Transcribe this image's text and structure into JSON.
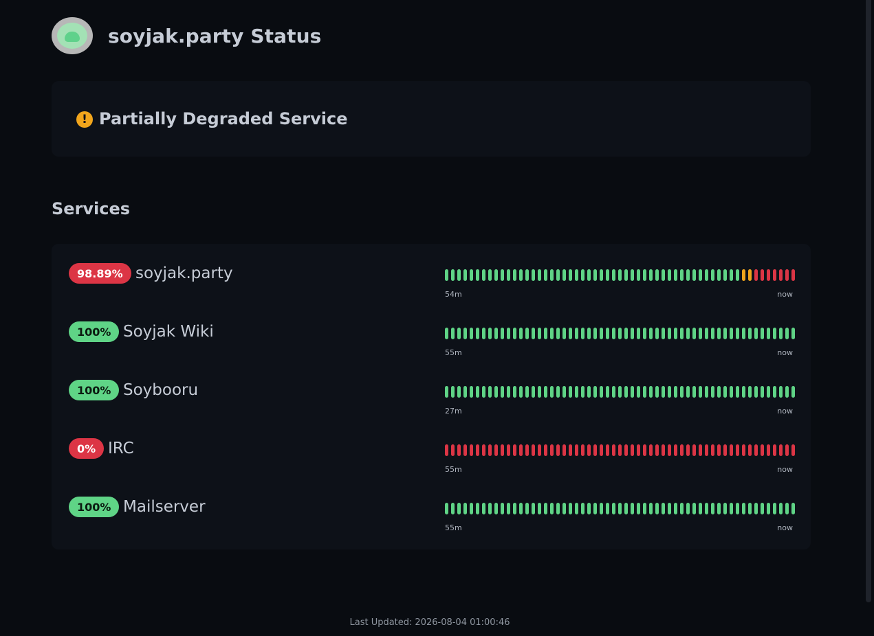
{
  "header": {
    "title": "soyjak.party Status",
    "logo_icon": "soyjak-logo-icon"
  },
  "overall_status": {
    "text": "Partially Degraded Service",
    "icon": "warning-exclamation-icon",
    "color": "#f1a51c"
  },
  "services_section": {
    "title": "Services"
  },
  "colors": {
    "up": "#5fd486",
    "down": "#dc3545",
    "degraded": "#f1a51c"
  },
  "services": [
    {
      "name": "soyjak.party",
      "uptime": "98.89%",
      "badge": "red",
      "range_start": "54m",
      "range_end": "now",
      "history": [
        "up",
        "up",
        "up",
        "up",
        "up",
        "up",
        "up",
        "up",
        "up",
        "up",
        "up",
        "up",
        "up",
        "up",
        "up",
        "up",
        "up",
        "up",
        "up",
        "up",
        "up",
        "up",
        "up",
        "up",
        "up",
        "up",
        "up",
        "up",
        "up",
        "up",
        "up",
        "up",
        "up",
        "up",
        "up",
        "up",
        "up",
        "up",
        "up",
        "up",
        "up",
        "up",
        "up",
        "up",
        "up",
        "up",
        "up",
        "up",
        "degraded",
        "degraded",
        "down",
        "down",
        "down",
        "down",
        "down",
        "down",
        "down"
      ]
    },
    {
      "name": "Soyjak Wiki",
      "uptime": "100%",
      "badge": "green",
      "range_start": "55m",
      "range_end": "now",
      "history": [
        "up",
        "up",
        "up",
        "up",
        "up",
        "up",
        "up",
        "up",
        "up",
        "up",
        "up",
        "up",
        "up",
        "up",
        "up",
        "up",
        "up",
        "up",
        "up",
        "up",
        "up",
        "up",
        "up",
        "up",
        "up",
        "up",
        "up",
        "up",
        "up",
        "up",
        "up",
        "up",
        "up",
        "up",
        "up",
        "up",
        "up",
        "up",
        "up",
        "up",
        "up",
        "up",
        "up",
        "up",
        "up",
        "up",
        "up",
        "up",
        "up",
        "up",
        "up",
        "up",
        "up",
        "up",
        "up",
        "up",
        "up"
      ]
    },
    {
      "name": "Soybooru",
      "uptime": "100%",
      "badge": "green",
      "range_start": "27m",
      "range_end": "now",
      "history": [
        "up",
        "up",
        "up",
        "up",
        "up",
        "up",
        "up",
        "up",
        "up",
        "up",
        "up",
        "up",
        "up",
        "up",
        "up",
        "up",
        "up",
        "up",
        "up",
        "up",
        "up",
        "up",
        "up",
        "up",
        "up",
        "up",
        "up",
        "up",
        "up",
        "up",
        "up",
        "up",
        "up",
        "up",
        "up",
        "up",
        "up",
        "up",
        "up",
        "up",
        "up",
        "up",
        "up",
        "up",
        "up",
        "up",
        "up",
        "up",
        "up",
        "up",
        "up",
        "up",
        "up",
        "up",
        "up",
        "up",
        "up"
      ]
    },
    {
      "name": "IRC",
      "uptime": "0%",
      "badge": "red",
      "range_start": "55m",
      "range_end": "now",
      "history": [
        "down",
        "down",
        "down",
        "down",
        "down",
        "down",
        "down",
        "down",
        "down",
        "down",
        "down",
        "down",
        "down",
        "down",
        "down",
        "down",
        "down",
        "down",
        "down",
        "down",
        "down",
        "down",
        "down",
        "down",
        "down",
        "down",
        "down",
        "down",
        "down",
        "down",
        "down",
        "down",
        "down",
        "down",
        "down",
        "down",
        "down",
        "down",
        "down",
        "down",
        "down",
        "down",
        "down",
        "down",
        "down",
        "down",
        "down",
        "down",
        "down",
        "down",
        "down",
        "down",
        "down",
        "down",
        "down",
        "down",
        "down"
      ]
    },
    {
      "name": "Mailserver",
      "uptime": "100%",
      "badge": "green",
      "range_start": "55m",
      "range_end": "now",
      "history": [
        "up",
        "up",
        "up",
        "up",
        "up",
        "up",
        "up",
        "up",
        "up",
        "up",
        "up",
        "up",
        "up",
        "up",
        "up",
        "up",
        "up",
        "up",
        "up",
        "up",
        "up",
        "up",
        "up",
        "up",
        "up",
        "up",
        "up",
        "up",
        "up",
        "up",
        "up",
        "up",
        "up",
        "up",
        "up",
        "up",
        "up",
        "up",
        "up",
        "up",
        "up",
        "up",
        "up",
        "up",
        "up",
        "up",
        "up",
        "up",
        "up",
        "up",
        "up",
        "up",
        "up",
        "up",
        "up",
        "up",
        "up"
      ]
    }
  ],
  "footer": {
    "label": "Last Updated:",
    "timestamp": "2026-08-04 01:00:46"
  }
}
